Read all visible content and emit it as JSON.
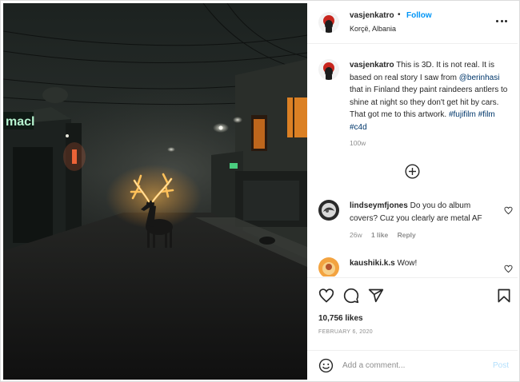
{
  "post": {
    "photo_sign_text": "macl",
    "author": {
      "username": "vasjenkatro",
      "separator": "•",
      "follow_label": "Follow",
      "location": "Korçë, Albania"
    },
    "caption": {
      "username": "vasjenkatro",
      "text_part1": "This is 3D. It is not real. It is based on real story I saw from",
      "mention": "@berinhasi",
      "text_part2": "that in Finland they paint raindeers antlers to shine at night so they don't get hit by cars. That got me to this artwork.",
      "hashtags": [
        "#fujifilm",
        "#film",
        "#c4d"
      ],
      "time": "100w"
    },
    "comments": [
      {
        "username": "lindseymfjones",
        "text": "Do you do album covers? Cuz you clearly are metal AF",
        "time": "26w",
        "likes": "1 like",
        "reply_label": "Reply"
      },
      {
        "username": "kaushiki.k.s",
        "text": "Wow!"
      }
    ],
    "likes": "10,756 likes",
    "date": "FEBRUARY 6, 2020",
    "add_comment": {
      "placeholder": "Add a comment...",
      "post_label": "Post"
    },
    "icons": {
      "more": "more-options-icon",
      "load_more": "plus-circle-icon",
      "like": "heart-icon",
      "comment": "comment-icon",
      "share": "send-icon",
      "save": "bookmark-icon",
      "emoji": "emoji-icon"
    },
    "colors": {
      "accent": "#0095f6",
      "link": "#00376b",
      "muted": "#8e8e8e",
      "post_disabled": "#b2dffc",
      "antler_glow": "#ffb84a"
    }
  }
}
